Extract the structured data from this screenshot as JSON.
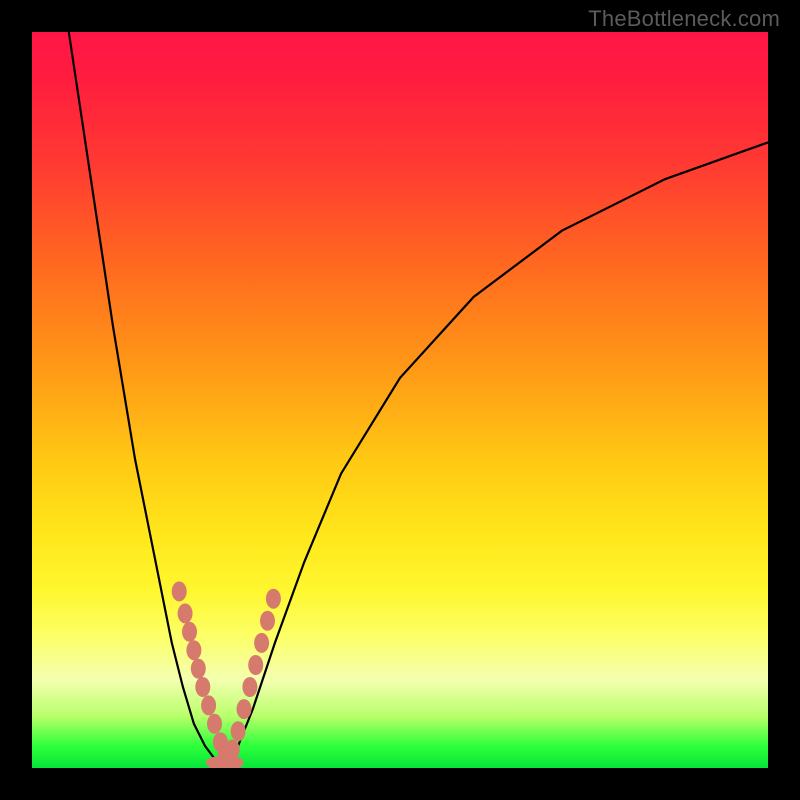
{
  "watermark": "TheBottleneck.com",
  "colors": {
    "frame": "#000000",
    "curve": "#000000",
    "bead": "#d77a6e",
    "gradient_stops": [
      "#ff1647",
      "#ff3a32",
      "#ff9a16",
      "#ffe61a",
      "#fcff66",
      "#2eff3a",
      "#06e53a"
    ]
  },
  "chart_data": {
    "type": "line",
    "title": "",
    "xlabel": "",
    "ylabel": "",
    "xlim": [
      0,
      100
    ],
    "ylim": [
      0,
      100
    ],
    "note": "Axes are unlabeled in the image; values are normalized 0–100 estimates read from pixel positions. y=0 is the green bottom edge, y=100 is the red top edge.",
    "series": [
      {
        "name": "left-curve",
        "x": [
          5,
          8,
          11,
          14,
          17,
          19,
          20.5,
          22,
          23.5,
          25,
          26
        ],
        "y": [
          100,
          80,
          60,
          42,
          27,
          17,
          11,
          6,
          3,
          1,
          0
        ]
      },
      {
        "name": "right-curve",
        "x": [
          26,
          28,
          30,
          33,
          37,
          42,
          50,
          60,
          72,
          86,
          100
        ],
        "y": [
          0,
          3,
          8,
          17,
          28,
          40,
          53,
          64,
          73,
          80,
          85
        ]
      }
    ],
    "annotations": {
      "beads_left": {
        "x": [
          20.0,
          20.8,
          21.4,
          22.0,
          22.6,
          23.2,
          24.0,
          24.8,
          25.6,
          26.2
        ],
        "y": [
          24,
          21,
          18.5,
          16,
          13.5,
          11,
          8.5,
          6,
          3.5,
          1.5
        ]
      },
      "beads_right": {
        "x": [
          27.2,
          28.0,
          28.8,
          29.6,
          30.4,
          31.2,
          32.0,
          32.8
        ],
        "y": [
          2.5,
          5,
          8,
          11,
          14,
          17,
          20,
          23
        ]
      },
      "beads_bottom": {
        "x": [
          25.0,
          25.8,
          26.6,
          27.4
        ],
        "y": [
          0.7,
          0.7,
          0.7,
          0.7
        ]
      }
    }
  }
}
